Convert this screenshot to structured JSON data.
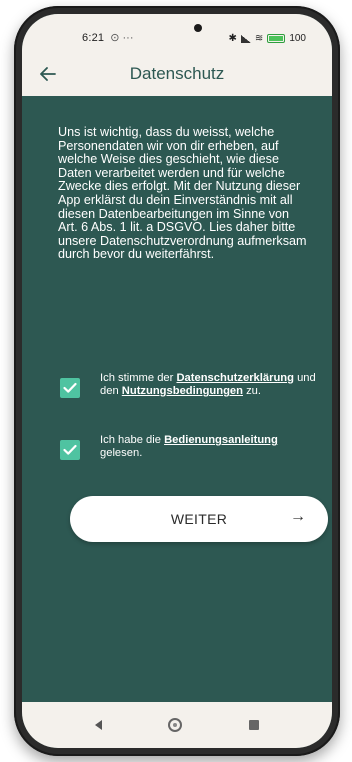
{
  "status_bar": {
    "time": "6:21",
    "extra": "⊙ ···",
    "right_text": "100"
  },
  "app_bar": {
    "title": "Datenschutz",
    "back_icon": "arrow-left-icon"
  },
  "intro_text": "Uns ist wichtig, dass du weisst, welche Personendaten wir von dir erheben, auf welche Weise dies geschieht, wie diese Daten verarbeitet werden und für welche Zwecke dies erfolgt. Mit der Nutzung dieser App erklärst du dein Einverständnis mit all diesen Datenbearbeitungen im Sinne von Art. 6 Abs. 1 lit. a DSGVO. Lies daher bitte unsere Datenschutzverordnung aufmerksam durch bevor du weiterfährst.",
  "consents": [
    {
      "checked": true,
      "prefix": "Ich stimme der ",
      "link1": "Datenschutzerklärung",
      "middle": " und den ",
      "link2": "Nutzungsbedingungen",
      "suffix": " zu."
    },
    {
      "checked": true,
      "prefix": "Ich habe die ",
      "link1": "Bedienungsanleitung",
      "suffix": " gelesen."
    }
  ],
  "continue_button": {
    "label": "WEITER",
    "arrow": "→"
  },
  "colors": {
    "background": "#2d5852",
    "bars": "#f4f1ec",
    "checkbox": "#4fc3a1"
  }
}
